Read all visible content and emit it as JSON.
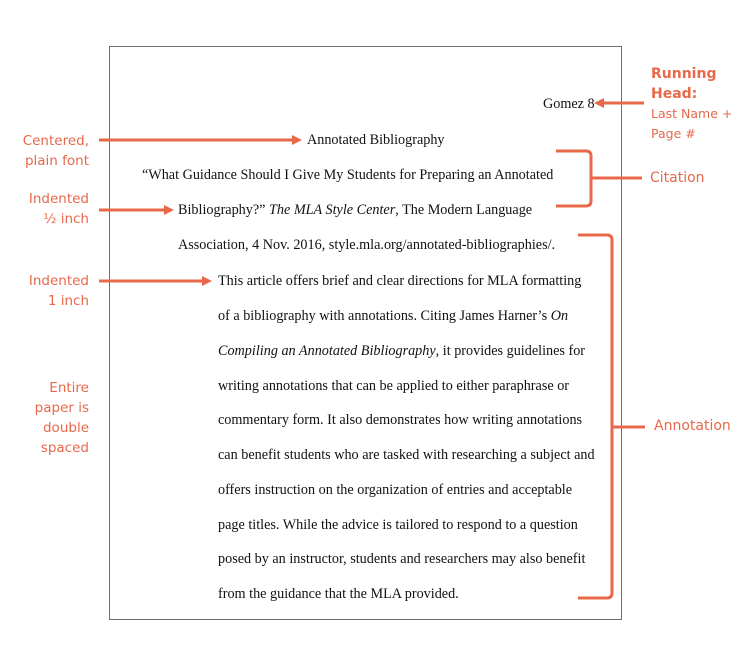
{
  "colors": {
    "accent": "#e8684a",
    "page_border": "#6e6e6e",
    "text": "#111111"
  },
  "document": {
    "running_head": "Gomez 8",
    "title": "Annotated Bibliography",
    "citation": {
      "line1": "“What Guidance Should I Give My Students for Preparing an Annotated",
      "line2_pre": "Bibliography?” ",
      "line2_italic": "The MLA Style Center",
      "line2_post": ", The Modern Language",
      "line3": "Association, 4 Nov. 2016, style.mla.org/annotated-bibliographies/."
    },
    "annotation": {
      "line1": "This article offers brief and clear directions for MLA formatting",
      "line2_pre": "of a bibliography with annotations. Citing James Harner’s ",
      "line2_italic": "On",
      "line3_italic": "Compiling an Annotated Bibliography",
      "line3_post": ", it provides guidelines for",
      "line4": "writing annotations that can be applied to either paraphrase or",
      "line5": "commentary form. It also demonstrates how writing annotations",
      "line6": "can benefit students who are tasked with researching a subject and",
      "line7": "offers instruction on the organization of entries and acceptable",
      "line8": "page titles. While the advice is tailored to respond to a question",
      "line9": "posed by an instructor, students and researchers may also benefit",
      "line10": "from the guidance that the MLA provided."
    }
  },
  "callouts": {
    "running_head": {
      "title_line1": "Running",
      "title_line2": "Head:",
      "sub_line1": "Last Name +",
      "sub_line2": "Page #"
    },
    "centered": {
      "line1": "Centered,",
      "line2": "plain font"
    },
    "indent_half": {
      "line1": "Indented",
      "line2": "½ inch"
    },
    "indent_one": {
      "line1": "Indented",
      "line2": "1 inch"
    },
    "double_spaced": {
      "line1": "Entire",
      "line2": "paper is",
      "line3": "double",
      "line4": "spaced"
    },
    "citation": "Citation",
    "annotation": "Annotation"
  }
}
